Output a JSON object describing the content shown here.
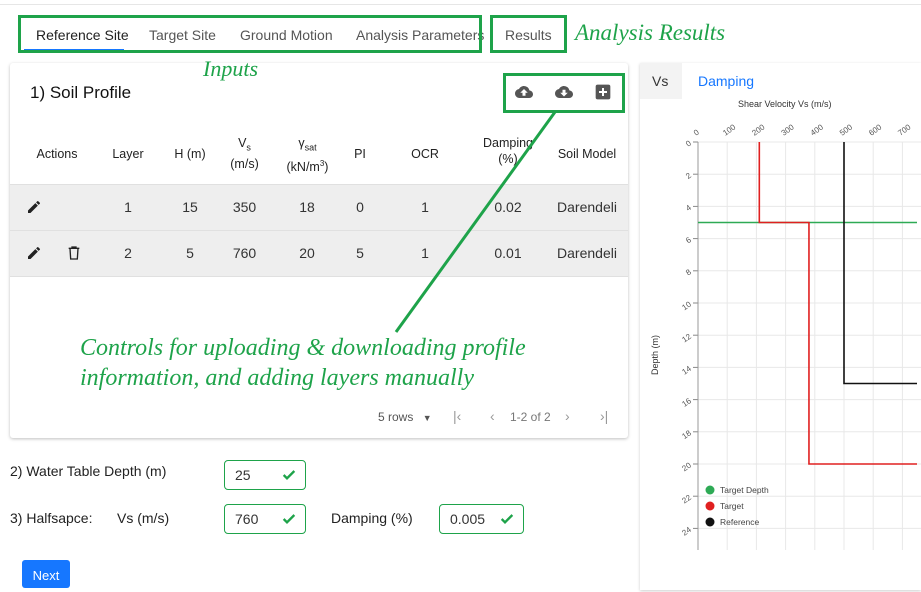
{
  "tabs": [
    {
      "label": "Reference Site",
      "active": true
    },
    {
      "label": "Target Site",
      "active": false
    },
    {
      "label": "Ground Motion",
      "active": false
    },
    {
      "label": "Analysis Parameters",
      "active": false
    }
  ],
  "results_tab": "Results",
  "annotations": {
    "analysis_results": "Analysis Results",
    "inputs": "Inputs",
    "controls_line1": "Controls for uploading & downloading profile",
    "controls_line2": "information, and adding layers manually"
  },
  "soil_profile": {
    "title": "1) Soil Profile",
    "icons": [
      "cloud-upload-icon",
      "cloud-download-icon",
      "add-layer-icon"
    ],
    "columns": {
      "actions": "Actions",
      "layer": "Layer",
      "h": "H (m)",
      "vs_main": "V",
      "vs_sub": "s",
      "vs_unit": "(m/s)",
      "gamma_main": "γ",
      "gamma_sub": "sat",
      "gamma_unit": "(kN/m",
      "gamma_unit_sup": "3",
      "gamma_unit_end": ")",
      "pi": "PI",
      "ocr": "OCR",
      "damping": "Damping",
      "damping_unit": "(%)",
      "soil_model": "Soil Model"
    },
    "rows": [
      {
        "layer": "1",
        "h": "15",
        "vs": "350",
        "gamma": "18",
        "pi": "0",
        "ocr": "1",
        "damping": "0.02",
        "model": "Darendeli"
      },
      {
        "layer": "2",
        "h": "5",
        "vs": "760",
        "gamma": "20",
        "pi": "5",
        "ocr": "1",
        "damping": "0.01",
        "model": "Darendeli"
      }
    ],
    "pagination": {
      "rows_per_page": "5 rows",
      "range": "1-2 of 2"
    }
  },
  "water_table": {
    "label": "2) Water Table Depth (m)",
    "value": "25"
  },
  "halfspace": {
    "label": "3) Halfsapce:",
    "vs_label": "Vs (m/s)",
    "vs_value": "760",
    "damping_label": "Damping (%)",
    "damping_value": "0.005"
  },
  "next_button": "Next",
  "results_panel": {
    "tabs": [
      {
        "label": "Vs",
        "active": true
      },
      {
        "label": "Damping",
        "active": false
      }
    ]
  },
  "chart_data": {
    "type": "line",
    "title": "Shear Velocity Vs (m/s)",
    "ylabel": "Depth (m)",
    "xlim": [
      0,
      750
    ],
    "ylim": [
      0,
      25
    ],
    "x_ticks": [
      "0",
      "100",
      "200",
      "300",
      "400",
      "500",
      "600",
      "700"
    ],
    "y_ticks": [
      "0",
      "2",
      "4",
      "6",
      "8",
      "10",
      "12",
      "14",
      "16",
      "18",
      "20",
      "22",
      "24"
    ],
    "series": [
      {
        "name": "Target Depth",
        "color": "#2eaa55",
        "x": [
          0,
          750
        ],
        "y": [
          5,
          5
        ]
      },
      {
        "name": "Target",
        "color": "#e02020",
        "x": [
          210,
          210,
          380,
          380,
          750
        ],
        "y": [
          0,
          5,
          5,
          20,
          20
        ]
      },
      {
        "name": "Reference",
        "color": "#111111",
        "x": [
          500,
          500,
          750
        ],
        "y": [
          0,
          15,
          15
        ]
      }
    ],
    "legend_position": "bottom-left",
    "grid": true
  }
}
